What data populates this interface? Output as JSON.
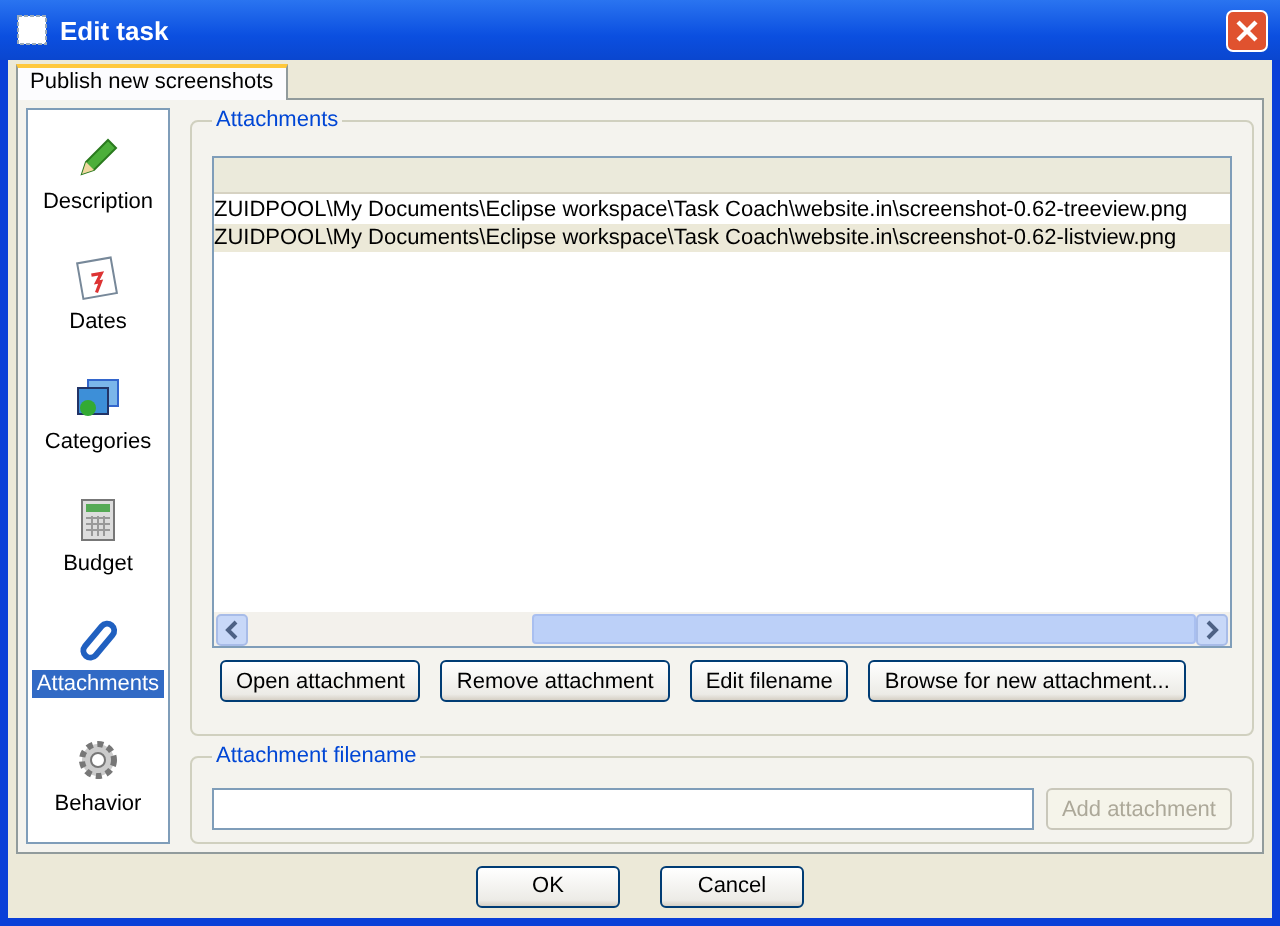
{
  "window": {
    "title": "Edit task"
  },
  "tabs": [
    {
      "label": "Publish new screenshots",
      "selected": true
    }
  ],
  "sidebar": {
    "items": [
      {
        "label": "Description",
        "kind": "pencil",
        "selected": false
      },
      {
        "label": "Dates",
        "kind": "calendar",
        "selected": false
      },
      {
        "label": "Categories",
        "kind": "folders",
        "selected": false
      },
      {
        "label": "Budget",
        "kind": "calculator",
        "selected": false
      },
      {
        "label": "Attachments",
        "kind": "paperclip",
        "selected": true
      },
      {
        "label": "Behavior",
        "kind": "gear",
        "selected": false
      }
    ]
  },
  "attachments": {
    "title": "Attachments",
    "rows": [
      {
        "path": "ZUIDPOOL\\My Documents\\Eclipse workspace\\Task Coach\\website.in\\screenshot-0.62-treeview.png",
        "selected": false
      },
      {
        "path": "ZUIDPOOL\\My Documents\\Eclipse workspace\\Task Coach\\website.in\\screenshot-0.62-listview.png",
        "selected": true
      }
    ],
    "buttons": [
      {
        "label": "Open attachment",
        "disabled": false
      },
      {
        "label": "Remove attachment",
        "disabled": false
      },
      {
        "label": "Edit filename",
        "disabled": false
      },
      {
        "label": "Browse for new attachment...",
        "disabled": false
      }
    ]
  },
  "filename": {
    "title": "Attachment filename",
    "button": {
      "label": "Add attachment",
      "disabled": true
    }
  },
  "buttons": [
    "OK",
    "Cancel"
  ]
}
